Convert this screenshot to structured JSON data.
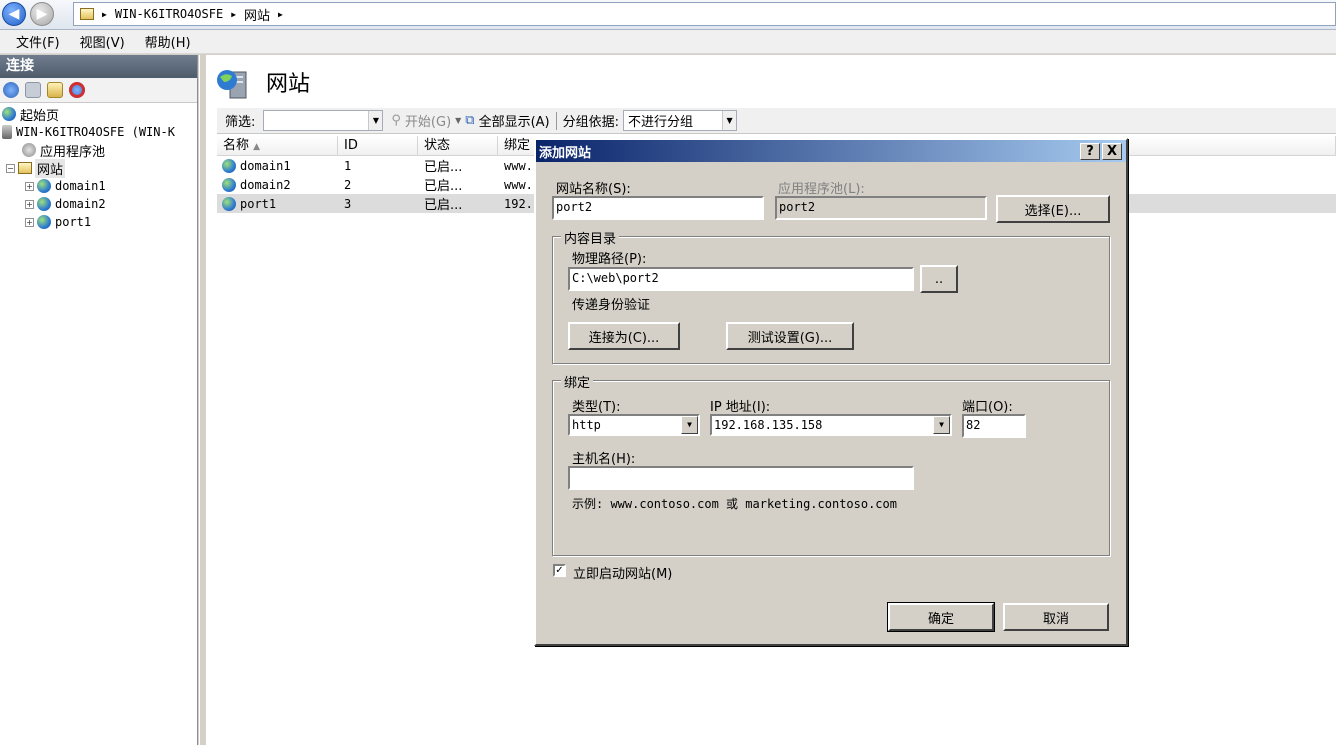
{
  "address": {
    "crumbs": [
      "WIN-K6ITRO4OSFE",
      "网站"
    ]
  },
  "menu": {
    "file": "文件(F)",
    "view": "视图(V)",
    "help": "帮助(H)"
  },
  "connections": {
    "title": "连接",
    "tree": {
      "start_page": "起始页",
      "server": "WIN-K6ITRO4OSFE (WIN-K",
      "app_pools": "应用程序池",
      "sites": "网站",
      "site_items": [
        "domain1",
        "domain2",
        "port1"
      ]
    }
  },
  "page": {
    "title": "网站"
  },
  "filter": {
    "label": "筛选:",
    "start": "开始(G)",
    "show_all": "全部显示(A)",
    "group_label": "分组依据:",
    "group_value": "不进行分组"
  },
  "grid": {
    "headers": [
      "名称",
      "ID",
      "状态",
      "绑定"
    ],
    "rows": [
      {
        "name": "domain1",
        "id": "1",
        "status": "已启...",
        "binding": "www."
      },
      {
        "name": "domain2",
        "id": "2",
        "status": "已启...",
        "binding": "www."
      },
      {
        "name": "port1",
        "id": "3",
        "status": "已启...",
        "binding": "192."
      }
    ]
  },
  "dialog": {
    "title": "添加网站",
    "help_btn": "?",
    "close_btn": "X",
    "site_name_label": "网站名称(S):",
    "site_name_value": "port2",
    "app_pool_label": "应用程序池(L):",
    "app_pool_value": "port2",
    "select_btn": "选择(E)...",
    "content_group": "内容目录",
    "physical_path_label": "物理路径(P):",
    "physical_path_value": "C:\\web\\port2",
    "browse_btn": "..",
    "pass_auth": "传递身份验证",
    "connect_as_btn": "连接为(C)...",
    "test_settings_btn": "测试设置(G)...",
    "binding_group": "绑定",
    "type_label": "类型(T):",
    "type_value": "http",
    "ip_label": "IP 地址(I):",
    "ip_value": "192.168.135.158",
    "port_label": "端口(O):",
    "port_value": "82",
    "host_label": "主机名(H):",
    "host_value": "",
    "example": "示例: www.contoso.com 或 marketing.contoso.com",
    "start_immediately": "立即启动网站(M)",
    "start_checked": true,
    "ok_btn": "确定",
    "cancel_btn": "取消"
  }
}
